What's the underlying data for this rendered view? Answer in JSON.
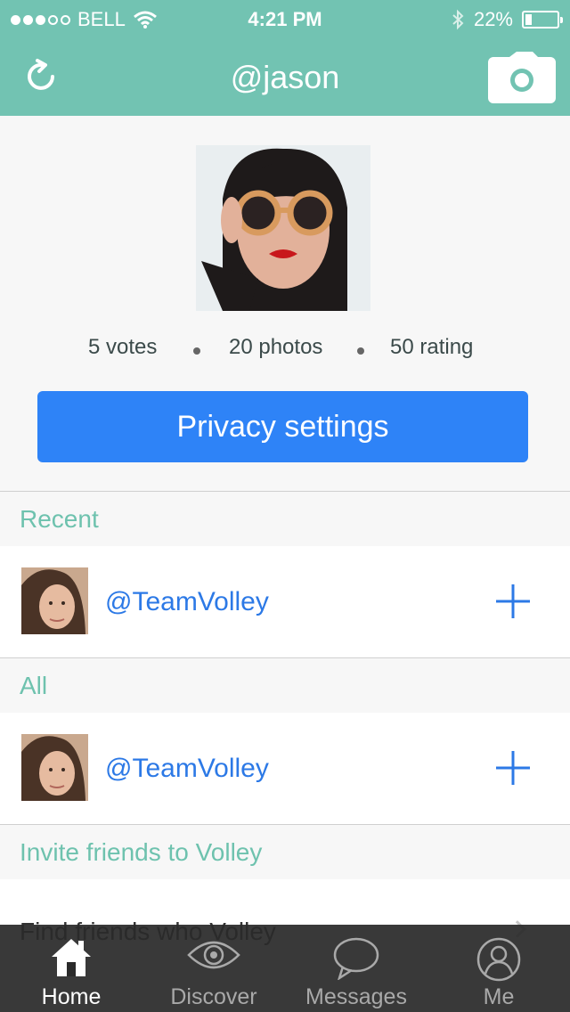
{
  "status_bar": {
    "carrier": "BELL",
    "time": "4:21 PM",
    "battery_percent": "22%",
    "battery_level": 0.22,
    "signal_bars_filled": 3,
    "signal_bars_total": 5
  },
  "nav": {
    "title": "@jason",
    "left_icon": "refresh-icon",
    "right_icon": "camera-icon"
  },
  "profile": {
    "votes": "5 votes",
    "photos": "20 photos",
    "rating": "50 rating",
    "privacy_button": "Privacy settings"
  },
  "sections": {
    "recent": {
      "header": "Recent",
      "items": [
        {
          "handle": "@TeamVolley"
        }
      ]
    },
    "all": {
      "header": "All",
      "items": [
        {
          "handle": "@TeamVolley"
        }
      ]
    },
    "invite": {
      "header": "Invite friends to Volley",
      "find_label": "Find friends who Volley"
    }
  },
  "tabs": [
    {
      "label": "Home",
      "icon": "home-icon",
      "active": true
    },
    {
      "label": "Discover",
      "icon": "eye-icon",
      "active": false
    },
    {
      "label": "Messages",
      "icon": "speech-bubble-icon",
      "active": false
    },
    {
      "label": "Me",
      "icon": "person-icon",
      "active": false
    }
  ],
  "colors": {
    "header_teal": "#72c3b2",
    "accent_blue": "#2e83f7",
    "link_blue": "#2c79e6",
    "section_teal_text": "#6ec2ae",
    "tabbar_dark": "#2a2a2a"
  }
}
